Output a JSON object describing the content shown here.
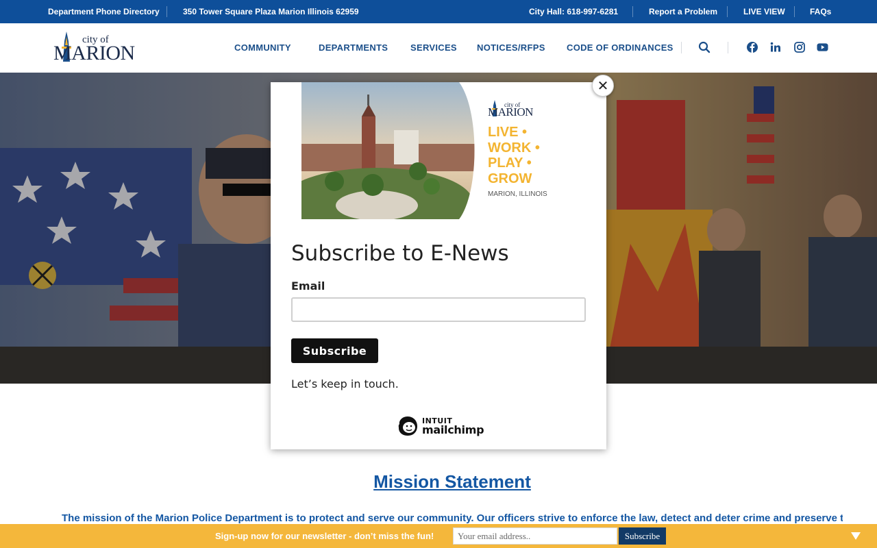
{
  "topbar": {
    "directory": "Department Phone Directory",
    "address": "350 Tower Square Plaza Marion Illinois 62959",
    "city_hall": "City Hall: 618-997-6281",
    "report": "Report a Problem",
    "live_view": "LIVE VIEW",
    "faqs": "FAQs"
  },
  "header": {
    "logo_city_of": "city of",
    "logo_marion": "MARION",
    "nav": [
      "COMMUNITY",
      "DEPARTMENTS",
      "SERVICES",
      "NOTICES/RFPS",
      "CODE OF ORDINANCES"
    ],
    "icons": [
      "search-icon",
      "facebook-icon",
      "linkedin-icon",
      "instagram-icon",
      "youtube-icon"
    ]
  },
  "modal": {
    "banner_city_of": "city of",
    "banner_marion": "MARION",
    "tagline": [
      "LIVE •",
      "WORK •",
      "PLAY •",
      "GROW"
    ],
    "location": "MARION, ILLINOIS",
    "title": "Subscribe to E-News",
    "email_label": "Email",
    "email_value": "",
    "subscribe_label": "Subscribe",
    "keep_in_touch": "Let’s keep in touch.",
    "mc_intuit": "INTUIT",
    "mc_name": "mailchimp",
    "close_label": "✕"
  },
  "main": {
    "mission_title": "Mission Statement",
    "mission_text": "The mission of the Marion Police Department is to protect and serve our community.  Our officers strive to enforce the law, detect and deter crime and preserve the"
  },
  "newsbar": {
    "message": "Sign-up now for our newsletter - don’t miss the fun!",
    "email_placeholder": "Your email address..",
    "subscribe_label": "Subscribe"
  },
  "colors": {
    "topbar": "#0e4f9a",
    "nav_text": "#1b4f8a",
    "newsbar": "#f4b73b",
    "tagline": "#f3b431",
    "mission": "#1457a3"
  }
}
